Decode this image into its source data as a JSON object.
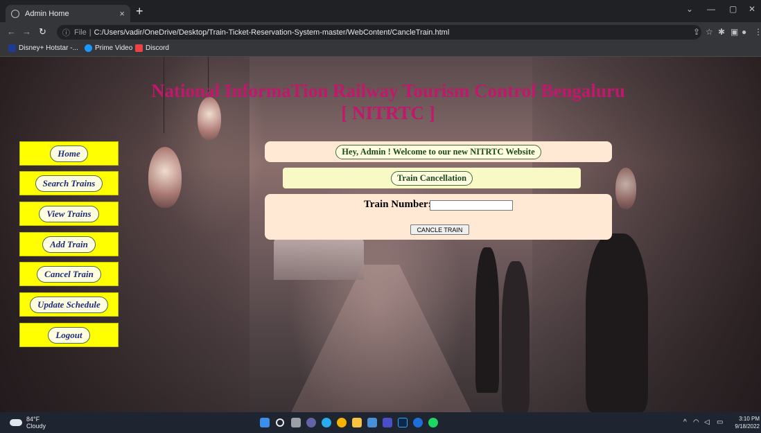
{
  "browser": {
    "tab_title": "Admin Home",
    "tab_close": "×",
    "new_tab": "+",
    "address_prefix": "File",
    "address_url": "C:/Users/vadir/OneDrive/Desktop/Train-Ticket-Reservation-System-master/WebContent/CancleTrain.html",
    "bookmarks": [
      {
        "label": "Disney+ Hotstar -...",
        "icon": "hotstar-icon",
        "color": "#1f3b8f"
      },
      {
        "label": "Prime Video",
        "icon": "prime-video-icon",
        "color": "#1a98ff"
      },
      {
        "label": "Discord",
        "icon": "discord-icon",
        "color": "#ed4245"
      }
    ]
  },
  "page": {
    "heading_line1": "National InformaTion Railway Tourism Control Bengaluru",
    "heading_line2": "[ NITRTC ]",
    "heading_color": "#c0186a",
    "nav": [
      {
        "label": "Home"
      },
      {
        "label": "Search Trains"
      },
      {
        "label": "View Trains"
      },
      {
        "label": "Add Train"
      },
      {
        "label": "Cancel Train"
      },
      {
        "label": "Update Schedule"
      },
      {
        "label": "Logout"
      }
    ],
    "nav_color": "#ffff00",
    "welcome": "Hey, Admin ! Welcome to our new NITRTC Website",
    "section_title": "Train Cancellation",
    "form": {
      "label": "Train Number:",
      "value": "",
      "submit": "CANCLE TRAIN"
    }
  },
  "taskbar": {
    "temperature": "84°F",
    "condition": "Cloudy",
    "time": "3:10 PM",
    "date": "9/18/2022"
  }
}
